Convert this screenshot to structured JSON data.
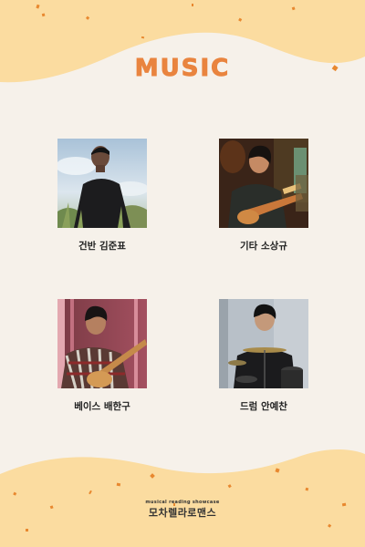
{
  "title": "MUSIC",
  "members": [
    {
      "caption": "건반 김준표",
      "photo": "photo-keyboard"
    },
    {
      "caption": "기타 소상규",
      "photo": "photo-guitar"
    },
    {
      "caption": "베이스 배한구",
      "photo": "photo-bass"
    },
    {
      "caption": "드럼 안예찬",
      "photo": "photo-drums"
    }
  ],
  "logo": {
    "subtitle": "musical reading showcase",
    "name": "모차렐라로맨스"
  },
  "colors": {
    "background": "#f6f1ea",
    "wave": "#fbdca0",
    "title": "#e9843f",
    "speckles": "#e8882f"
  }
}
